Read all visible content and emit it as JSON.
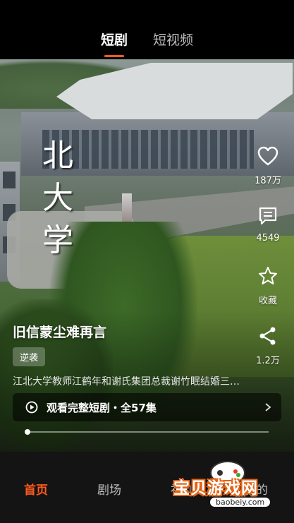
{
  "top_tabs": [
    {
      "label": "短剧",
      "active": true
    },
    {
      "label": "短视频",
      "active": false
    }
  ],
  "video": {
    "overlay_text": [
      "北",
      "大",
      "学"
    ],
    "actions": {
      "like_count": "187万",
      "comment_count": "4549",
      "favorite_label": "收藏",
      "share_count": "1.2万"
    },
    "title": "旧信蒙尘难再言",
    "tag": "逆袭",
    "description": "江北大学教师江鹤年和谢氏集团总裁谢竹眠结婚三…",
    "watch_full_label": "观看完整短剧・全57集",
    "progress": 0.01
  },
  "bottom_nav": [
    {
      "label": "首页",
      "active": true
    },
    {
      "label": "剧场",
      "active": false
    },
    {
      "label": "福利",
      "active": false
    },
    {
      "label": "我的",
      "active": false
    }
  ],
  "watermark": {
    "text": "宝贝游戏网",
    "url": "baobeiy.com"
  },
  "colors": {
    "accent": "#ff5a1f",
    "nav_background": "#141414"
  }
}
